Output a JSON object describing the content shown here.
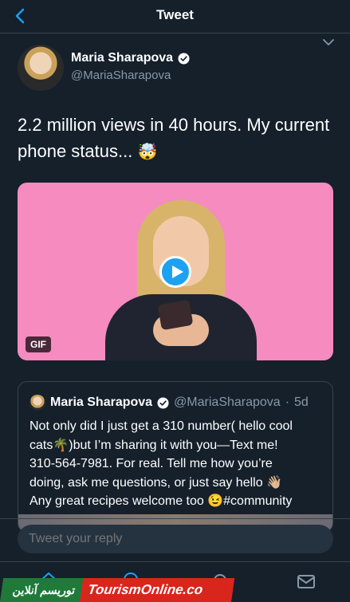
{
  "header": {
    "title": "Tweet",
    "back_icon": "chevron-left-icon"
  },
  "tweet": {
    "author_name": "Maria Sharapova",
    "author_handle": "@MariaSharapova",
    "verified": true,
    "text": "2.2 million views in 40 hours. My current phone status...",
    "text_emoji": "🤯",
    "media": {
      "badge": "GIF",
      "play_icon": "play-icon"
    },
    "quoted": {
      "author_name": "Maria Sharapova",
      "author_handle": "@MariaSharapova",
      "separator": "·",
      "age": "5d",
      "lines": [
        "Not only did I just get a 310 number( hello cool",
        "cats🌴)but I’m sharing it with you—Text me!",
        "310-564-7981. For real. Tell me how you’re",
        "doing, ask me questions, or just say hello 👋🏼",
        "Any great recipes welcome too 😉#community"
      ]
    }
  },
  "reply": {
    "placeholder": "Tweet your reply"
  },
  "tabbar": {
    "items": [
      "home-icon",
      "search-icon",
      "notifications-icon",
      "messages-icon"
    ]
  },
  "watermark": {
    "fa_text": "توریسم آنلاین",
    "en_text": "TourismOnline.co"
  },
  "colors": {
    "background": "#15202b",
    "accent": "#1da1f2",
    "secondary_text": "#8899a6",
    "border": "#38444d"
  }
}
